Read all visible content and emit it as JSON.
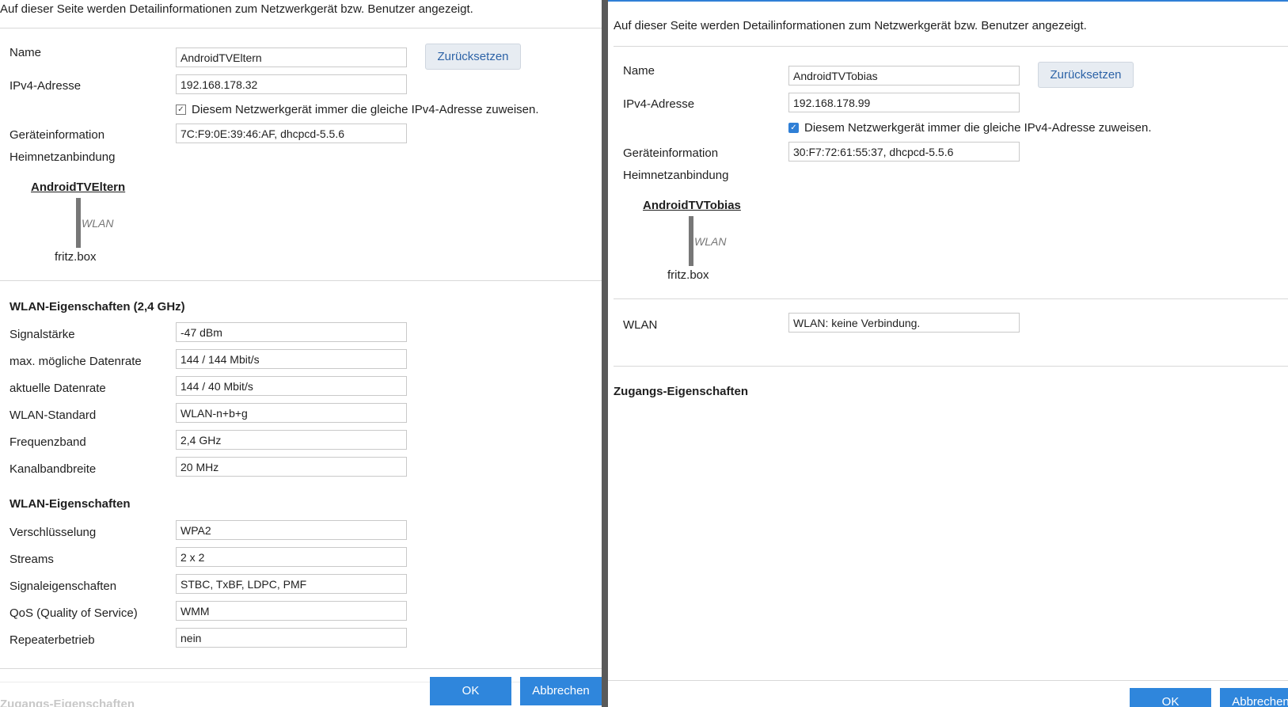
{
  "left": {
    "intro": "Auf dieser Seite werden Detailinformationen zum Netzwerkgerät bzw. Benutzer angezeigt.",
    "name_label": "Name",
    "name_value": "AndroidTVEltern",
    "reset_label": "Zurücksetzen",
    "ipv4_label": "IPv4-Adresse",
    "ipv4_value": "192.168.178.32",
    "checkbox_label": "Diesem Netzwerkgerät immer die gleiche IPv4-Adresse zuweisen.",
    "device_info_label": "Geräteinformation",
    "device_info_value": "7C:F9:0E:39:46:AF, dhcpcd-5.5.6",
    "home_network_label": "Heimnetzanbindung",
    "topology": {
      "device": "AndroidTVEltern",
      "connection": "WLAN",
      "router": "fritz.box"
    },
    "wlan24_title": "WLAN-Eigenschaften (2,4 GHz)",
    "wlan24_rows": [
      {
        "label": "Signalstärke",
        "value": "-47 dBm"
      },
      {
        "label": "max. mögliche Datenrate",
        "value": "144 / 144 Mbit/s"
      },
      {
        "label": "aktuelle Datenrate",
        "value": "144 / 40 Mbit/s"
      },
      {
        "label": "WLAN-Standard",
        "value": "WLAN-n+b+g"
      },
      {
        "label": "Frequenzband",
        "value": "2,4 GHz"
      },
      {
        "label": "Kanalbandbreite",
        "value": "20 MHz"
      }
    ],
    "wlan_title": "WLAN-Eigenschaften",
    "wlan_rows": [
      {
        "label": "Verschlüsselung",
        "value": "WPA2"
      },
      {
        "label": "Streams",
        "value": "2 x 2"
      },
      {
        "label": "Signaleigenschaften",
        "value": "STBC, TxBF, LDPC, PMF"
      },
      {
        "label": "QoS (Quality of Service)",
        "value": "WMM"
      },
      {
        "label": "Repeaterbetrieb",
        "value": "nein"
      }
    ],
    "access_title_partial": "Zugangs-Eigenschaften",
    "ok_label": "OK",
    "cancel_label": "Abbrechen"
  },
  "right": {
    "intro": "Auf dieser Seite werden Detailinformationen zum Netzwerkgerät bzw. Benutzer angezeigt.",
    "name_label": "Name",
    "name_value": "AndroidTVTobias",
    "reset_label": "Zurücksetzen",
    "ipv4_label": "IPv4-Adresse",
    "ipv4_value": "192.168.178.99",
    "checkbox_label": "Diesem Netzwerkgerät immer die gleiche IPv4-Adresse zuweisen.",
    "device_info_label": "Geräteinformation",
    "device_info_value": "30:F7:72:61:55:37, dhcpcd-5.5.6",
    "home_network_label": "Heimnetzanbindung",
    "topology": {
      "device": "AndroidTVTobias",
      "connection": "WLAN",
      "router": "fritz.box"
    },
    "wlan_label": "WLAN",
    "wlan_value": "WLAN: keine Verbindung.",
    "access_title": "Zugangs-Eigenschaften",
    "ok_label": "OK",
    "cancel_label": "Abbrechen"
  },
  "colors": {
    "accent": "#2f86dc",
    "reset_bg": "#e7ecf2",
    "link_text": "#2d63a7"
  }
}
